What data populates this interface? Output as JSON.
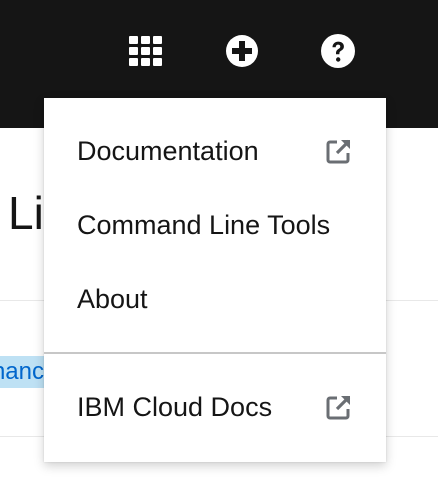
{
  "masthead": {
    "icons": [
      {
        "name": "app-launcher-icon"
      },
      {
        "name": "plus-circle-icon"
      },
      {
        "name": "help-icon"
      }
    ]
  },
  "page": {
    "title_fragment": "Li",
    "row_link_fragment": "hanc"
  },
  "help_menu": {
    "items": [
      {
        "label": "Documentation",
        "external": true
      },
      {
        "label": "Command Line Tools",
        "external": false
      },
      {
        "label": "About",
        "external": false
      },
      {
        "label": "IBM Cloud Docs",
        "external": true
      }
    ]
  },
  "colors": {
    "masthead": "#151515",
    "text": "#151515",
    "link": "#0066cc",
    "link_highlight": "#bee1f4",
    "icon_gray": "#6a6e73"
  }
}
